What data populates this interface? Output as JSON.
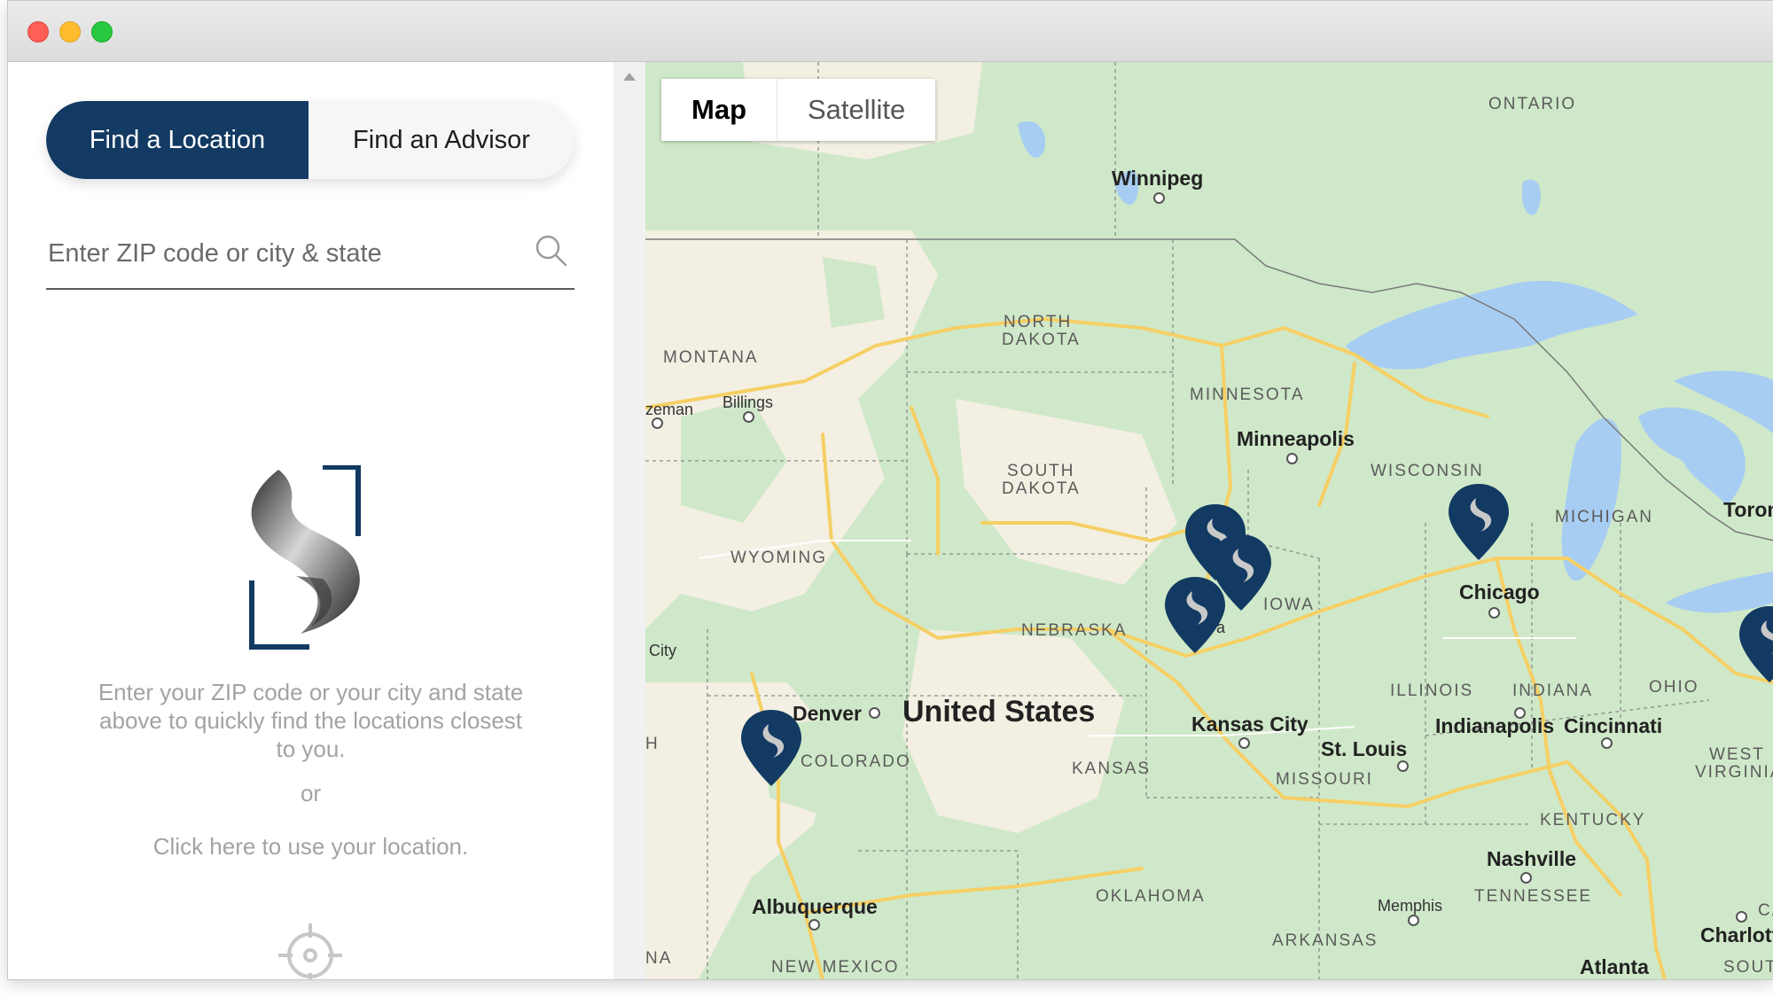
{
  "window": {
    "controls": [
      "close",
      "minimize",
      "zoom"
    ]
  },
  "sidebar": {
    "tabs": [
      {
        "label": "Find a Location",
        "active": true
      },
      {
        "label": "Find an Advisor",
        "active": false
      }
    ],
    "search": {
      "placeholder": "Enter ZIP code or city & state",
      "value": ""
    },
    "instructions": "Enter your ZIP code or your city and state above to quickly find the locations closest to you.",
    "or_text": "or",
    "use_location_link": "Click here to use your location."
  },
  "map": {
    "type_controls": [
      {
        "label": "Map",
        "active": true
      },
      {
        "label": "Satellite",
        "active": false
      }
    ],
    "country_label": "United States",
    "states": {
      "montana": "MONTANA",
      "north_dakota_1": "NORTH",
      "north_dakota_2": "DAKOTA",
      "south_dakota_1": "SOUTH",
      "south_dakota_2": "DAKOTA",
      "minnesota": "MINNESOTA",
      "wyoming": "WYOMING",
      "nebraska": "NEBRASKA",
      "iowa": "IOWA",
      "wisconsin": "WISCONSIN",
      "michigan": "MICHIGAN",
      "illinois": "ILLINOIS",
      "indiana": "INDIANA",
      "ohio": "OHIO",
      "colorado": "COLORADO",
      "kansas": "KANSAS",
      "missouri": "MISSOURI",
      "west_virginia_1": "WEST",
      "west_virginia_2": "VIRGINIA",
      "kentucky": "KENTUCKY",
      "tennessee": "TENNESSEE",
      "oklahoma": "OKLAHOMA",
      "arkansas": "ARKANSAS",
      "new_mexico": "NEW MEXICO",
      "ontario": "ONTARIO",
      "south_edge": "SOUTH",
      "nevada_edge": "NA",
      "utah_edge": "H",
      "ca_edge": "CA"
    },
    "cities": {
      "winnipeg": "Winnipeg",
      "minneapolis": "Minneapolis",
      "chicago": "Chicago",
      "denver": "Denver",
      "kansas_city": "Kansas City",
      "st_louis": "St. Louis",
      "indianapolis": "Indianapolis",
      "cincinnati": "Cincinnati",
      "nashville": "Nashville",
      "albuquerque": "Albuquerque",
      "memphis": "Memphis",
      "billings": "Billings",
      "bozeman": "zeman",
      "toronto": "Toron",
      "charlotte": "Charlott",
      "atlanta": "Atlanta",
      "salt_lake": "City",
      "omaha_partial": "a"
    },
    "colors": {
      "land_green": "#cfe8c9",
      "land_tan": "#f3efe2",
      "water": "#a7cdf2",
      "road": "#f6cf65",
      "pin": "#123a62",
      "accent": "#123a62"
    }
  }
}
